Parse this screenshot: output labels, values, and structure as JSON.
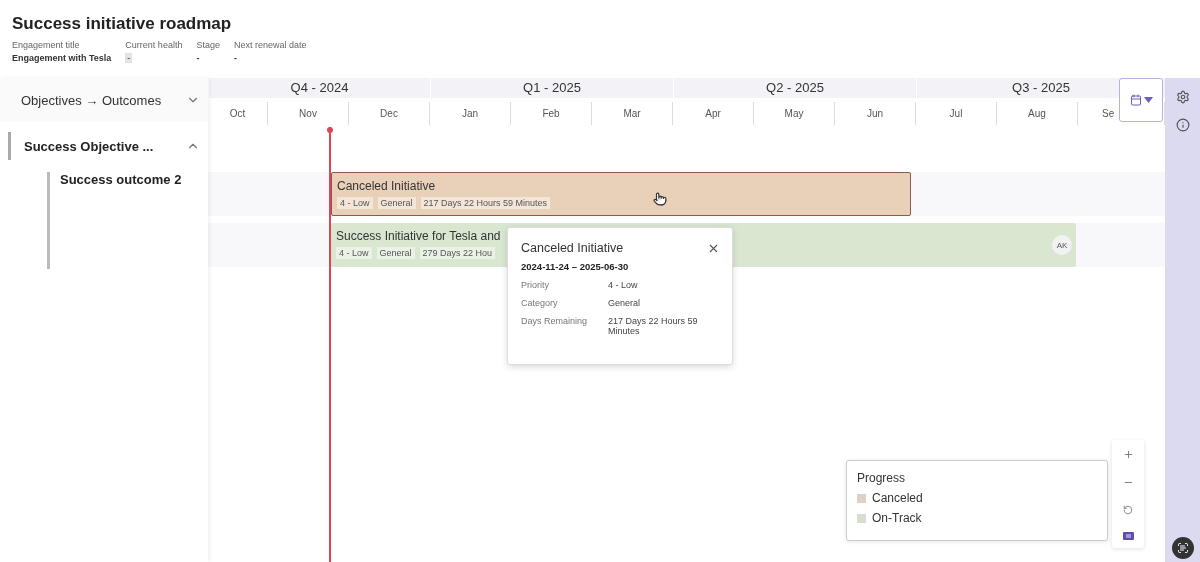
{
  "title": "Success initiative roadmap",
  "fields": [
    {
      "label": "Engagement title",
      "value": "Engagement with Tesla",
      "kind": "plain"
    },
    {
      "label": "Current health",
      "value": "-",
      "kind": "chip"
    },
    {
      "label": "Stage",
      "value": "-",
      "kind": "plain"
    },
    {
      "label": "Next renewal date",
      "value": "-",
      "kind": "plain"
    }
  ],
  "tree": {
    "header": "Objectives → Outcomes",
    "expanded": false,
    "objectives": [
      {
        "label": "Success Objective ...",
        "expanded": true,
        "children": [
          {
            "label": "Success outcome 2"
          }
        ]
      }
    ]
  },
  "quarters": [
    "Q4 - 2024",
    "Q1 - 2025",
    "Q2 - 2025",
    "Q3 - 2025"
  ],
  "months": [
    "Oct",
    "Nov",
    "Dec",
    "Jan",
    "Feb",
    "Mar",
    "Apr",
    "May",
    "Jun",
    "Jul",
    "Aug",
    "Se"
  ],
  "bars": [
    {
      "title": "Canceled Initiative",
      "tags": [
        "4 - Low",
        "General",
        "217 Days 22 Hours 59 Minutes"
      ],
      "color": "#e9d0b9",
      "selected": true
    },
    {
      "title": "Success Initiative for Tesla and",
      "tags": [
        "4 - Low",
        "General",
        "279 Days 22 Hou"
      ],
      "color": "#d9e7d1",
      "selected": false,
      "avatar": "AK"
    }
  ],
  "tooltip": {
    "title": "Canceled Initiative",
    "dates": "2024-11-24 – 2025-06-30",
    "rows": [
      {
        "label": "Priority",
        "value": "4 - Low"
      },
      {
        "label": "Category",
        "value": "General"
      },
      {
        "label": "Days Remaining",
        "value": "217 Days 22 Hours 59 Minutes"
      }
    ]
  },
  "legend": {
    "title": "Progress",
    "items": [
      {
        "label": "Canceled",
        "color": "#dfd2c2"
      },
      {
        "label": "On-Track",
        "color": "#d6ddd1"
      }
    ]
  }
}
